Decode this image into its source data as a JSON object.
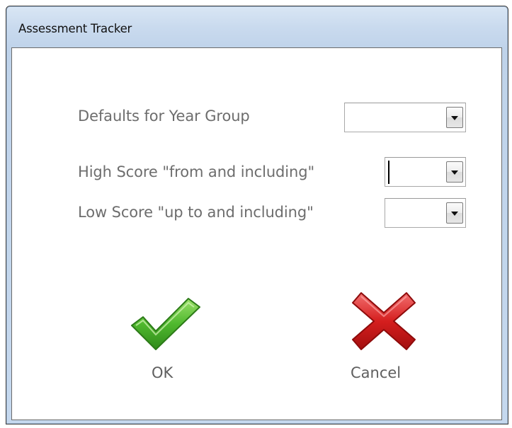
{
  "window": {
    "title": "Assessment Tracker"
  },
  "form": {
    "year_group": {
      "label": "Defaults for Year Group",
      "value": ""
    },
    "high_score": {
      "label": "High Score \"from and including\"",
      "value": ""
    },
    "low_score": {
      "label": "Low Score \"up to and including\"",
      "value": ""
    }
  },
  "actions": {
    "ok_label": "OK",
    "cancel_label": "Cancel"
  },
  "icons": {
    "ok": "checkmark-icon",
    "cancel": "cross-icon",
    "dropdown": "chevron-down-icon"
  },
  "colors": {
    "ok_green": "#4caf2c",
    "cancel_red": "#d01a1a"
  }
}
